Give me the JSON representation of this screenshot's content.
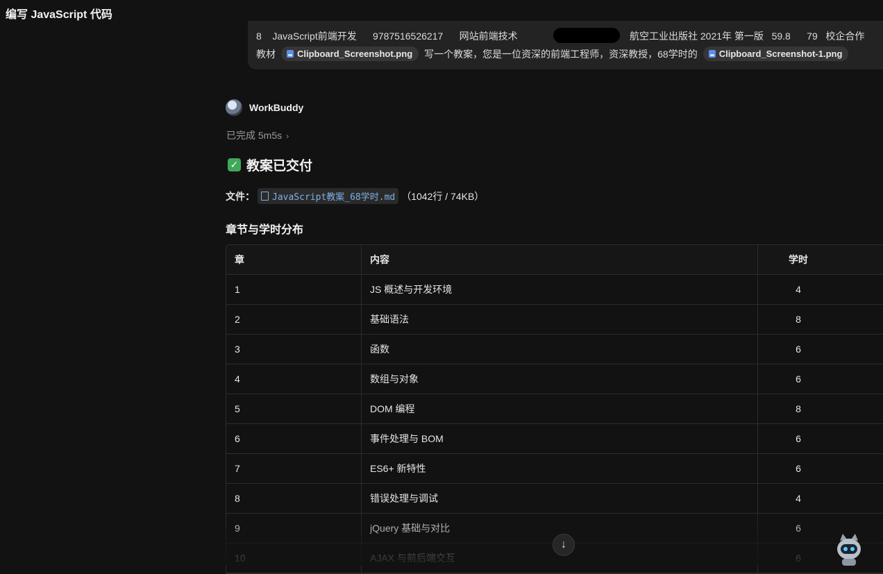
{
  "window": {
    "title": "编写 JavaScript 代码"
  },
  "user_message": {
    "line1_a": "8    JavaScript前端开发      9787516526217      网站前端技术",
    "line1_b": "航空工业出版社 2021年 第一版   59.8      79   校企合作",
    "line2_prefix": "教材",
    "attachment1": "Clipboard_Screenshot.png",
    "middle_text": "写一个教案，您是一位资深的前端工程师，资深教授，68学时的",
    "attachment2": "Clipboard_Screenshot-1.png"
  },
  "assistant": {
    "name": "WorkBuddy",
    "status": "已完成 5m5s",
    "delivered_title": "教案已交付",
    "file_label": "文件：",
    "file_name": "JavaScript教案_68学时.md",
    "file_meta": "（1042行 / 74KB）",
    "section_title": "章节与学时分布"
  },
  "table": {
    "headers": [
      "章",
      "内容",
      "学时"
    ],
    "rows": [
      [
        "1",
        "JS 概述与开发环境",
        "4"
      ],
      [
        "2",
        "基础语法",
        "8"
      ],
      [
        "3",
        "函数",
        "6"
      ],
      [
        "4",
        "数组与对象",
        "6"
      ],
      [
        "5",
        "DOM 编程",
        "8"
      ],
      [
        "6",
        "事件处理与 BOM",
        "6"
      ],
      [
        "7",
        "ES6+ 新特性",
        "6"
      ],
      [
        "8",
        "错误处理与调试",
        "4"
      ],
      [
        "9",
        "jQuery 基础与对比",
        "6"
      ],
      [
        "10",
        "AJAX 与前后端交互",
        "6"
      ]
    ]
  },
  "icons": {
    "check": "✓",
    "chevron": "›",
    "scroll_down": "↓"
  },
  "colors": {
    "background": "#121212",
    "accent_link": "#7fb0e6",
    "success": "#3fa95b"
  }
}
